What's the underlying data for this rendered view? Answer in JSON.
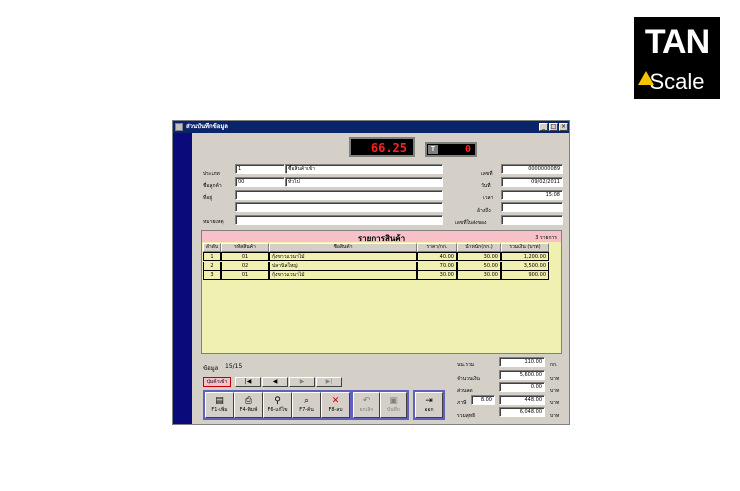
{
  "logo": {
    "line1": "TAN",
    "line2": "Scale"
  },
  "window": {
    "title": "ส่วนบันทึกข้อมูล",
    "btn_min": "_",
    "btn_max": "□",
    "btn_close": "×"
  },
  "display": {
    "weight": "66.25",
    "tare_label": "T",
    "tare_value": "0"
  },
  "form": {
    "type_label": "ประเภท",
    "type_code": "1",
    "type_name": "ซื้อสินค้าเข้า",
    "customer_label": "ชื่อลูกค้า",
    "customer_code": "00",
    "customer_name": "ทั่วไป",
    "address_label": "ที่อยู่",
    "note_label": "หมายเหตุ",
    "doc_no_label": "เลขที่",
    "doc_no": "0000000089",
    "date_label": "วันที่",
    "date": "09/02/2011",
    "time_label": "เวลา",
    "time": "15:08",
    "ref_label": "อ้างถึง",
    "delivery_label": "เลขที่ใบส่งของ"
  },
  "grid": {
    "title": "รายการสินค้า",
    "count": "3  รายการ",
    "columns": [
      "ลำดับ",
      "รหัสสินค้า",
      "ชื่อสินค้า",
      "ราคา/กก.",
      "น้ำหนัก(กก.)",
      "รวมเงิน (บาท)"
    ],
    "rows": [
      [
        "1",
        "01",
        "กุ้งขาวแวนาไม้",
        "40.00",
        "30.00",
        "1,200.00"
      ],
      [
        "2",
        "02",
        "ปลานิลใหญ่",
        "70.00",
        "50.00",
        "3,500.00"
      ],
      [
        "3",
        "01",
        "กุ้งขาวแวนาไม้",
        "30.00",
        "30.00",
        "900.00"
      ]
    ]
  },
  "record": {
    "label": "ข้อมูล",
    "value": "15/15"
  },
  "nav": {
    "history": "ปุ่มค้าเข้า",
    "first": "|◀",
    "prev": "◀",
    "next": "▶",
    "last": "▶|"
  },
  "toolbar": {
    "f1": "F1-เพิ่ม",
    "f4": "F4-พิมพ์",
    "f6": "F6-แก้ไข",
    "f7": "F7-ค้น",
    "f8": "F8-ลบ",
    "cancel": "ยกเลิก",
    "save": "บันทึก",
    "exit": "ออก"
  },
  "totals": {
    "weight_label": "นน.รวม",
    "weight": "110.00",
    "weight_unit": "กก.",
    "amount_label": "จำนวนเงิน",
    "amount": "5,600.00",
    "amount_unit": "บาท",
    "discount_label": "ส่วนลด",
    "discount": "0.00",
    "discount_unit": "บาท",
    "vat_label": "ภาษี",
    "vat_rate": "8.00",
    "vat": "448.00",
    "vat_unit": "บาท",
    "net_label": "รวมสุทธิ",
    "net": "6,048.00",
    "net_unit": "บาท"
  }
}
